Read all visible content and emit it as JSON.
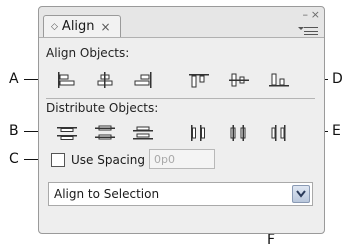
{
  "panel": {
    "tab_label": "Align",
    "tab_close": "×",
    "minimize": "–",
    "close": "×"
  },
  "align_objects": {
    "label": "Align Objects:",
    "buttons": [
      "align-left-edges",
      "align-horizontal-centers",
      "align-right-edges",
      "align-top-edges",
      "align-vertical-centers",
      "align-bottom-edges"
    ]
  },
  "distribute_objects": {
    "label": "Distribute Objects:",
    "buttons": [
      "distribute-top-edges",
      "distribute-vertical-centers",
      "distribute-bottom-edges",
      "distribute-left-edges",
      "distribute-horizontal-centers",
      "distribute-right-edges"
    ]
  },
  "use_spacing": {
    "label": "Use Spacing",
    "checked": false,
    "value": "0p0"
  },
  "align_to": {
    "selected": "Align to Selection"
  },
  "callouts": {
    "a": "A",
    "b": "B",
    "c": "C",
    "d": "D",
    "e": "E",
    "f": "F"
  }
}
